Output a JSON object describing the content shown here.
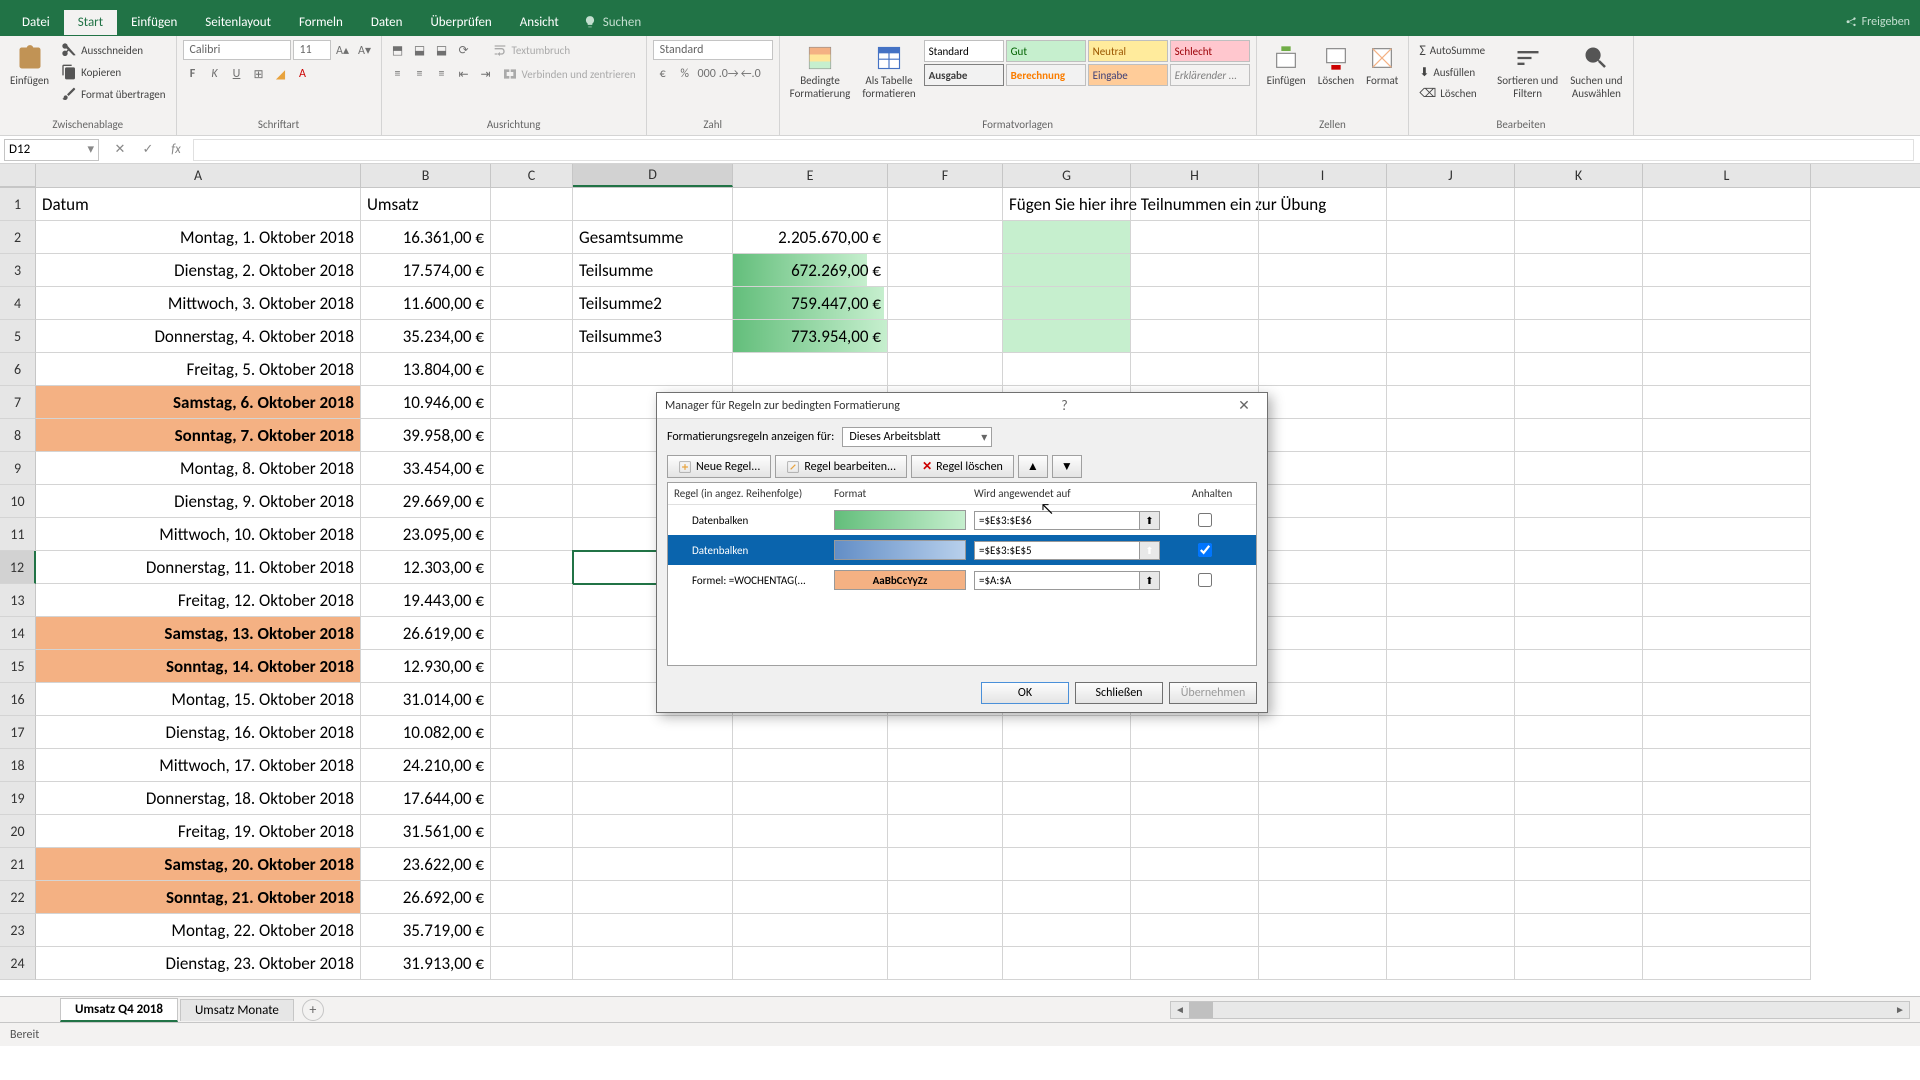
{
  "tabs": {
    "datei": "Datei",
    "start": "Start",
    "einfuegen": "Einfügen",
    "seitenlayout": "Seitenlayout",
    "formeln": "Formeln",
    "daten": "Daten",
    "ueberpruefen": "Überprüfen",
    "ansicht": "Ansicht",
    "suchen": "Suchen",
    "freigeben": "Freigeben"
  },
  "ribbon": {
    "einfuegen": "Einfügen",
    "ausschneiden": "Ausschneiden",
    "kopieren": "Kopieren",
    "format_ueber": "Format übertragen",
    "zwischenablage": "Zwischenablage",
    "font": "Calibri",
    "size": "11",
    "schriftart": "Schriftart",
    "ausrichtung": "Ausrichtung",
    "textumbruch": "Textumbruch",
    "verbinden": "Verbinden und zentrieren",
    "zahl_label": "Zahl",
    "zahl_sel": "Standard",
    "bedingte": "Bedingte",
    "formatierung": "Formatierung",
    "als_tabelle": "Als Tabelle",
    "formatieren": "formatieren",
    "formatvorlagen": "Formatvorlagen",
    "styles": {
      "standard": "Standard",
      "gut": "Gut",
      "neutral": "Neutral",
      "schlecht": "Schlecht",
      "ausgabe": "Ausgabe",
      "berechnung": "Berechnung",
      "eingabe": "Eingabe",
      "erklaerend": "Erklärender ..."
    },
    "zellen": "Zellen",
    "einfg": "Einfügen",
    "loeschen": "Löschen",
    "format": "Format",
    "bearbeiten": "Bearbeiten",
    "autosumme": "AutoSumme",
    "ausfuellen": "Ausfüllen",
    "loeschen2": "Löschen",
    "sortieren": "Sortieren und",
    "filtern": "Filtern",
    "suchen": "Suchen und",
    "auswaehlen": "Auswählen"
  },
  "namebox": "D12",
  "cols": [
    "A",
    "B",
    "C",
    "D",
    "E",
    "F",
    "G",
    "H",
    "I",
    "J",
    "K",
    "L"
  ],
  "headers": {
    "a1": "Datum",
    "b1": "Umsatz",
    "g1": "Fügen Sie hier ihre Teilnummen ein zur Übung"
  },
  "sums": {
    "d2": "Gesamtsumme",
    "e2": "2.205.670,00 €",
    "d3": "Teilsumme",
    "e3": "672.269,00 €",
    "d4": "Teilsumme2",
    "e4": "759.447,00 €",
    "d5": "Teilsumme3",
    "e5": "773.954,00 €"
  },
  "rows": [
    {
      "a": "Montag, 1. Oktober 2018",
      "b": "16.361,00 €",
      "we": false
    },
    {
      "a": "Dienstag, 2. Oktober 2018",
      "b": "17.574,00 €",
      "we": false
    },
    {
      "a": "Mittwoch, 3. Oktober 2018",
      "b": "11.600,00 €",
      "we": false
    },
    {
      "a": "Donnerstag, 4. Oktober 2018",
      "b": "35.234,00 €",
      "we": false
    },
    {
      "a": "Freitag, 5. Oktober 2018",
      "b": "13.804,00 €",
      "we": false
    },
    {
      "a": "Samstag, 6. Oktober 2018",
      "b": "10.946,00 €",
      "we": true
    },
    {
      "a": "Sonntag, 7. Oktober 2018",
      "b": "39.958,00 €",
      "we": true
    },
    {
      "a": "Montag, 8. Oktober 2018",
      "b": "33.454,00 €",
      "we": false
    },
    {
      "a": "Dienstag, 9. Oktober 2018",
      "b": "29.669,00 €",
      "we": false
    },
    {
      "a": "Mittwoch, 10. Oktober 2018",
      "b": "23.095,00 €",
      "we": false
    },
    {
      "a": "Donnerstag, 11. Oktober 2018",
      "b": "12.303,00 €",
      "we": false
    },
    {
      "a": "Freitag, 12. Oktober 2018",
      "b": "19.443,00 €",
      "we": false
    },
    {
      "a": "Samstag, 13. Oktober 2018",
      "b": "26.619,00 €",
      "we": true
    },
    {
      "a": "Sonntag, 14. Oktober 2018",
      "b": "12.930,00 €",
      "we": true
    },
    {
      "a": "Montag, 15. Oktober 2018",
      "b": "31.014,00 €",
      "we": false
    },
    {
      "a": "Dienstag, 16. Oktober 2018",
      "b": "10.082,00 €",
      "we": false
    },
    {
      "a": "Mittwoch, 17. Oktober 2018",
      "b": "24.210,00 €",
      "we": false
    },
    {
      "a": "Donnerstag, 18. Oktober 2018",
      "b": "17.644,00 €",
      "we": false
    },
    {
      "a": "Freitag, 19. Oktober 2018",
      "b": "31.561,00 €",
      "we": false
    },
    {
      "a": "Samstag, 20. Oktober 2018",
      "b": "23.622,00 €",
      "we": true
    },
    {
      "a": "Sonntag, 21. Oktober 2018",
      "b": "26.692,00 €",
      "we": true
    },
    {
      "a": "Montag, 22. Oktober 2018",
      "b": "35.719,00 €",
      "we": false
    },
    {
      "a": "Dienstag, 23. Oktober 2018",
      "b": "31.913,00 €",
      "we": false
    }
  ],
  "sheets": {
    "active": "Umsatz Q4 2018",
    "other": "Umsatz Monate"
  },
  "status": "Bereit",
  "dialog": {
    "title": "Manager für Regeln zur bedingten Formatierung",
    "show_for": "Formatierungsregeln anzeigen für:",
    "scope": "Dieses Arbeitsblatt",
    "new_rule": "Neue Regel...",
    "edit_rule": "Regel bearbeiten...",
    "del_rule": "Regel löschen",
    "col_rule": "Regel (in angez. Reihenfolge)",
    "col_format": "Format",
    "col_applies": "Wird angewendet auf",
    "col_stop": "Anhalten",
    "rules": [
      {
        "name": "Datenbalken",
        "fmt": "green",
        "range": "=$E$3:$E$6",
        "stop": false,
        "sel": false
      },
      {
        "name": "Datenbalken",
        "fmt": "blue",
        "range": "=$E$3:$E$5",
        "stop": true,
        "sel": true
      },
      {
        "name": "Formel: =WOCHENTAG(...",
        "fmt": "orange",
        "range": "=$A:$A",
        "stop": false,
        "sel": false
      }
    ],
    "fmt_sample": "AaBbCcYyZz",
    "ok": "OK",
    "close": "Schließen",
    "apply": "Übernehmen"
  }
}
